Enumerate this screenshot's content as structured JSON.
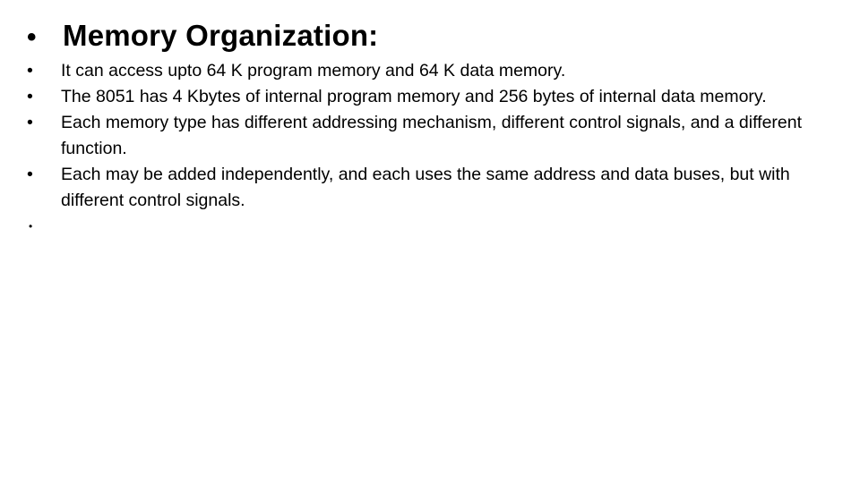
{
  "slide": {
    "title": "Memory Organization:",
    "title_bullet": "•",
    "bullet_glyph": "•",
    "bullets": [
      {
        "text": "It can access upto 64 K program memory and 64 K data memory."
      },
      {
        "text": "The 8051 has 4 Kbytes of internal program memory and 256 bytes of internal data memory."
      },
      {
        "text": "Each memory type has different addressing mechanism, different control signals, and a different function."
      },
      {
        "text": "Each may be added independently, and each uses the same address and data buses, but with different control signals."
      },
      {
        "text": ""
      }
    ]
  }
}
